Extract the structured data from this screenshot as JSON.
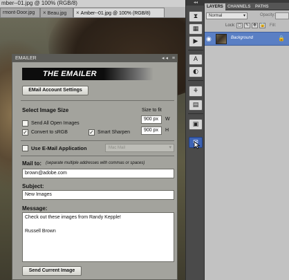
{
  "document": {
    "title_partial": "mber--01.jpg @ 100% (RGB/8)",
    "tabs": [
      {
        "label": "rmont-Door.jpg",
        "active": false
      },
      {
        "label": "Beau.jpg",
        "active": false
      },
      {
        "label": "Amber--01.jpg @ 100% (RGB/8)",
        "active": true
      }
    ],
    "tab_close_glyph": "×"
  },
  "emailer": {
    "panel_title": "EMAILER",
    "titlebar_controls": "◂◂ ≡",
    "banner_text": "THE EMAILER",
    "settings_button": "EMail Account Settings",
    "select_image_size_label": "Select Image Size",
    "size_to_fit_label": "Size to fit",
    "send_all_open_images": {
      "label": "Send All Open Images",
      "checked": false
    },
    "convert_to_srgb": {
      "label": "Convert to sRGB",
      "checked": true
    },
    "smart_sharpen": {
      "label": "Smart Sharpen",
      "checked": true
    },
    "width_value": "900 px",
    "width_unit": "W",
    "height_value": "900 px",
    "height_unit": "H",
    "use_email_application": {
      "label": "Use E-Mail Application",
      "checked": false
    },
    "mail_app_select": "Mac Mail",
    "mail_to_label": "Mail to:",
    "mail_to_hint": "(separate multiple addresses with commas or spaces)",
    "mail_to_value": "brown@adobe.com",
    "subject_label": "Subject:",
    "subject_value": "New Images",
    "message_label": "Message:",
    "message_value": "Check out these images from Randy Kepple!\n\nRussell Brown",
    "send_button": "Send Current Image",
    "check_glyph": "✓"
  },
  "dock": {
    "top_glyph": "◂◂",
    "tools": [
      {
        "name": "history-icon",
        "glyph": "⧗"
      },
      {
        "name": "swatches-icon",
        "glyph": "▦"
      },
      {
        "name": "actions-icon",
        "glyph": "▶"
      },
      {
        "name": "character-icon",
        "glyph": "A"
      },
      {
        "name": "adjustments-icon",
        "glyph": "◐"
      },
      {
        "name": "clone-source-icon",
        "glyph": "⚘"
      },
      {
        "name": "brushes-icon",
        "glyph": "▤"
      },
      {
        "name": "navigator-icon",
        "glyph": "▣"
      },
      {
        "name": "emailer-panel-icon",
        "glyph": "✉"
      }
    ]
  },
  "layers_panel": {
    "tabs": [
      "LAYERS",
      "CHANNELS",
      "PATHS"
    ],
    "blend_mode": "Normal",
    "opacity_label": "Opacity:",
    "lock_label": "Lock:",
    "lock_glyphs": [
      "▢",
      "✎",
      "✥",
      "🔒"
    ],
    "fill_label": "Fill:",
    "layer_name": "Background",
    "eye_glyph": "◉",
    "lock_glyph": "🔒"
  },
  "colors": {
    "emailer_bg": "#a3a39d",
    "selected_layer": "#5a7fc4",
    "active_tool": "#3d63b5"
  }
}
